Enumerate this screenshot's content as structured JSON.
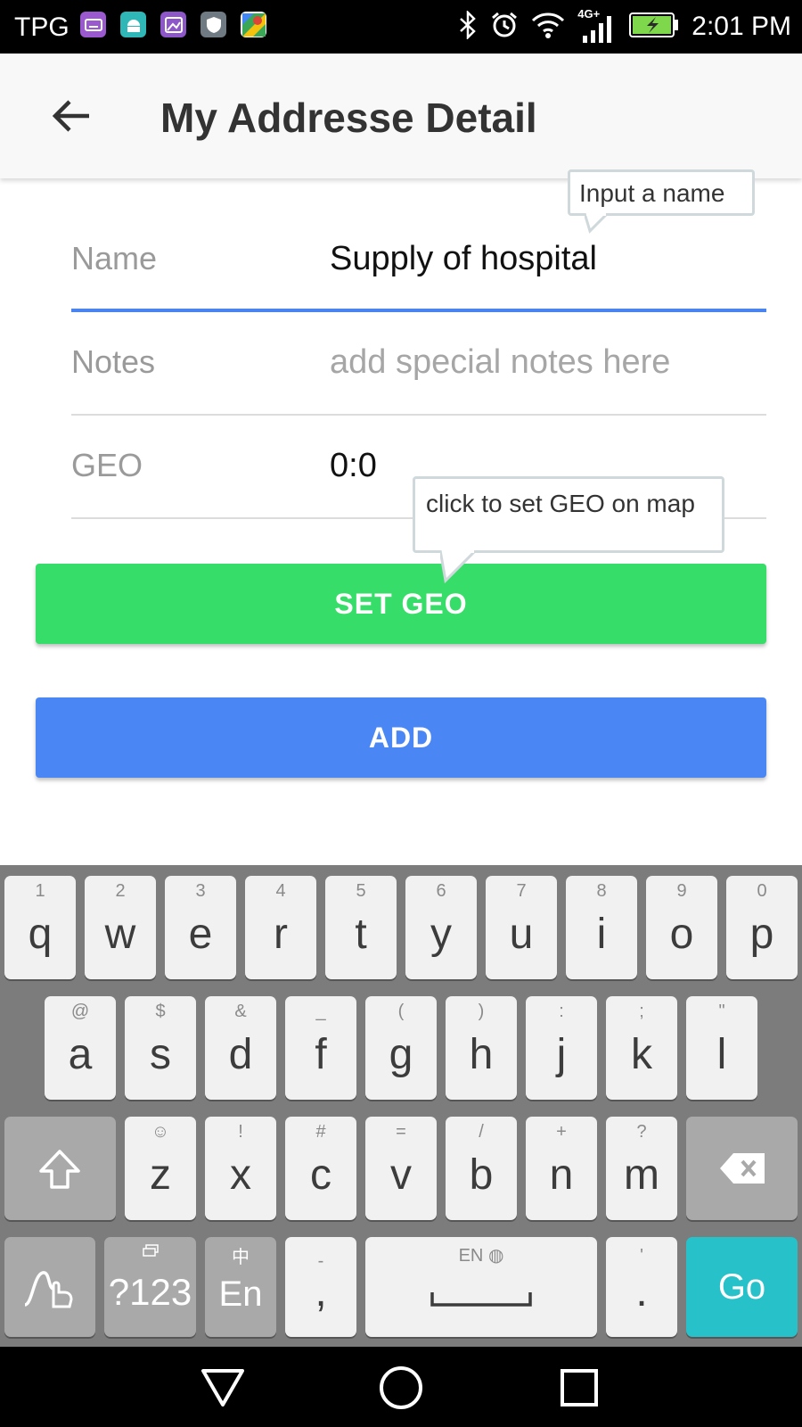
{
  "status_bar": {
    "carrier": "TPG",
    "network": "4G+",
    "time": "2:01 PM",
    "app_icons": [
      {
        "name": "keyboard-app-icon",
        "color": "#9b59d0"
      },
      {
        "name": "android-app-icon",
        "color": "#2fb6b6"
      },
      {
        "name": "gallery-app-icon",
        "color": "#8e57c9"
      },
      {
        "name": "shield-app-icon",
        "color": "#6f7a82"
      },
      {
        "name": "maps-app-icon",
        "color": "#ffffff"
      }
    ]
  },
  "app_bar": {
    "title": "My Addresse Detail"
  },
  "form": {
    "name": {
      "label": "Name",
      "value": "Supply of hospital"
    },
    "notes": {
      "label": "Notes",
      "placeholder": "add special notes here"
    },
    "geo": {
      "label": "GEO",
      "value": "0:0"
    }
  },
  "tooltips": {
    "name": "Input a name",
    "geo": "click to set GEO on map"
  },
  "buttons": {
    "set_geo": "SET GEO",
    "add": "ADD"
  },
  "colors": {
    "set_geo_button": "#36de69",
    "add_button": "#4a87f5",
    "active_underline": "#4a84f0",
    "go_key": "#26c1c9"
  },
  "keyboard": {
    "row1": [
      {
        "key": "q",
        "hint": "1"
      },
      {
        "key": "w",
        "hint": "2"
      },
      {
        "key": "e",
        "hint": "3"
      },
      {
        "key": "r",
        "hint": "4"
      },
      {
        "key": "t",
        "hint": "5"
      },
      {
        "key": "y",
        "hint": "6"
      },
      {
        "key": "u",
        "hint": "7"
      },
      {
        "key": "i",
        "hint": "8"
      },
      {
        "key": "o",
        "hint": "9"
      },
      {
        "key": "p",
        "hint": "0"
      }
    ],
    "row2": [
      {
        "key": "a",
        "hint": "@"
      },
      {
        "key": "s",
        "hint": "$"
      },
      {
        "key": "d",
        "hint": "&"
      },
      {
        "key": "f",
        "hint": "_"
      },
      {
        "key": "g",
        "hint": "("
      },
      {
        "key": "h",
        "hint": ")"
      },
      {
        "key": "j",
        "hint": ":"
      },
      {
        "key": "k",
        "hint": ";"
      },
      {
        "key": "l",
        "hint": "\""
      }
    ],
    "row3": [
      {
        "key": "z",
        "hint": "☺"
      },
      {
        "key": "x",
        "hint": "!"
      },
      {
        "key": "c",
        "hint": "#"
      },
      {
        "key": "v",
        "hint": "="
      },
      {
        "key": "b",
        "hint": "/"
      },
      {
        "key": "n",
        "hint": "+"
      },
      {
        "key": "m",
        "hint": "?"
      }
    ],
    "symbols_label": "?123",
    "lang_label": "En",
    "lang_hint": "中",
    "comma": ",",
    "comma_hint": "-",
    "space_hint": "EN",
    "period": ".",
    "period_hint": "'",
    "go_label": "Go"
  }
}
